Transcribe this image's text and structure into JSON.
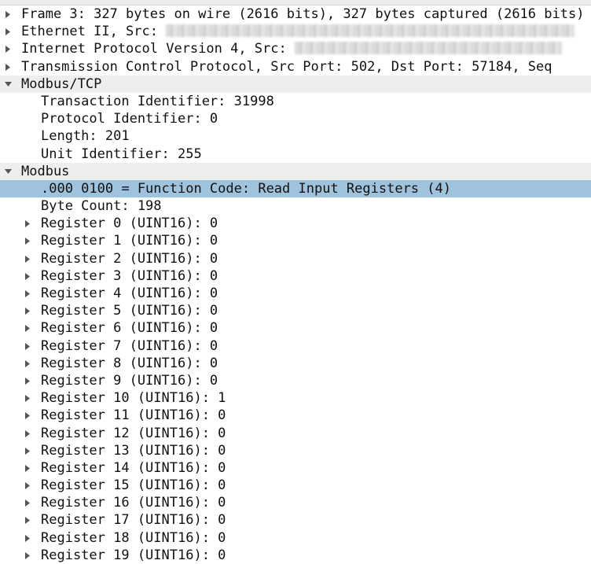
{
  "tree": {
    "frame": "Frame 3: 327 bytes on wire (2616 bits), 327 bytes captured (2616 bits)",
    "ethernet_prefix": "Ethernet II, Src:",
    "ip_prefix": "Internet Protocol Version 4, Src:",
    "tcp": "Transmission Control Protocol, Src Port: 502, Dst Port: 57184, Seq",
    "modbus_tcp": {
      "label": "Modbus/TCP",
      "fields": [
        "Transaction Identifier: 31998",
        "Protocol Identifier: 0",
        "Length: 201",
        "Unit Identifier: 255"
      ]
    },
    "modbus": {
      "label": "Modbus",
      "function_code": ".000 0100 = Function Code: Read Input Registers (4)",
      "byte_count": "Byte Count: 198",
      "registers": [
        "Register 0 (UINT16): 0",
        "Register 1 (UINT16): 0",
        "Register 2 (UINT16): 0",
        "Register 3 (UINT16): 0",
        "Register 4 (UINT16): 0",
        "Register 5 (UINT16): 0",
        "Register 6 (UINT16): 0",
        "Register 7 (UINT16): 0",
        "Register 8 (UINT16): 0",
        "Register 9 (UINT16): 0",
        "Register 10 (UINT16): 1",
        "Register 11 (UINT16): 0",
        "Register 12 (UINT16): 0",
        "Register 13 (UINT16): 0",
        "Register 14 (UINT16): 0",
        "Register 15 (UINT16): 0",
        "Register 16 (UINT16): 0",
        "Register 17 (UINT16): 0",
        "Register 18 (UINT16): 0",
        "Register 19 (UINT16): 0"
      ]
    }
  },
  "colors": {
    "selection": "#9fc3dc",
    "header_shade": "#eeeeee",
    "arrow": "#555555"
  },
  "icons": {
    "collapsed": "triangle-right-icon",
    "expanded": "triangle-down-icon"
  }
}
